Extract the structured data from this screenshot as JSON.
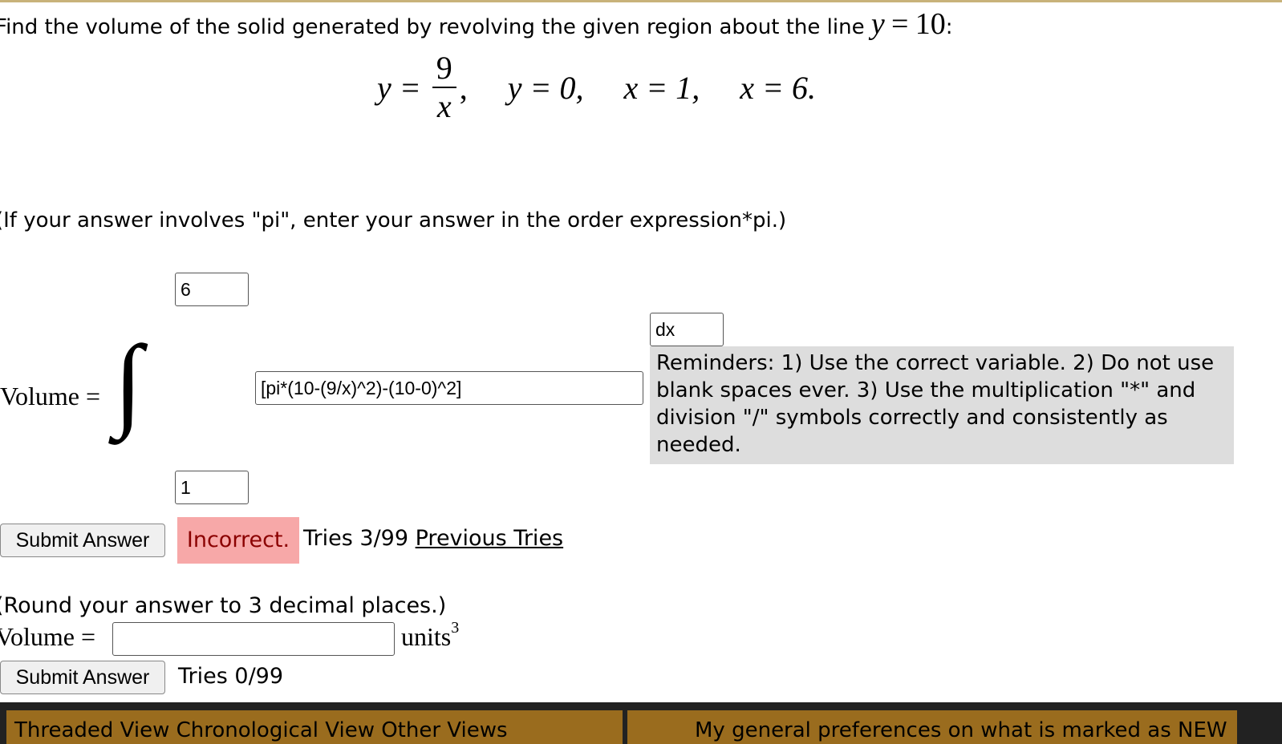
{
  "question": {
    "prefix": "Find the volume of the solid generated by revolving the given region about the line",
    "axis_var": "y",
    "axis_eq": "=",
    "axis_val": "10",
    "suffix": ":"
  },
  "region": {
    "eq1_lhs": "y =",
    "eq1_num": "9",
    "eq1_den": "x",
    "eq1_comma": ",",
    "eq2": "y = 0,",
    "eq3": "x = 1,",
    "eq4": "x = 6."
  },
  "hint_pi": "(If your answer involves \"pi\", enter your answer in the order expression*pi.)",
  "integral": {
    "label": "Volume =",
    "symbol": "∫",
    "upper_value": "6",
    "lower_value": "1",
    "integrand_value": "[pi*(10-(9/x)^2)-(10-0)^2]",
    "differential_value": "dx"
  },
  "reminder": "Reminders: 1) Use the correct variable. 2) Do not use blank spaces ever. 3) Use the multiplication \"*\" and division \"/\" symbols correctly and consistently as needed.",
  "submit1": {
    "button_label": "Submit Answer",
    "status": "Incorrect.",
    "tries": "Tries 3/99",
    "previous_link": "Previous Tries"
  },
  "hint_round": "(Round your answer to 3 decimal places.)",
  "answer2": {
    "label": "Volume =",
    "value": "",
    "units": "units",
    "units_exp": "3"
  },
  "submit2": {
    "button_label": "Submit Answer",
    "tries": "Tries 0/99"
  },
  "bottom_tabs": {
    "left": "Threaded View   Chronological View   Other Views",
    "right": "My general preferences on what is marked as NEW"
  },
  "colors": {
    "incorrect_bg": "#f7a8a8",
    "reminder_bg": "#dddddd",
    "tab_bg": "#9a6c1e"
  }
}
